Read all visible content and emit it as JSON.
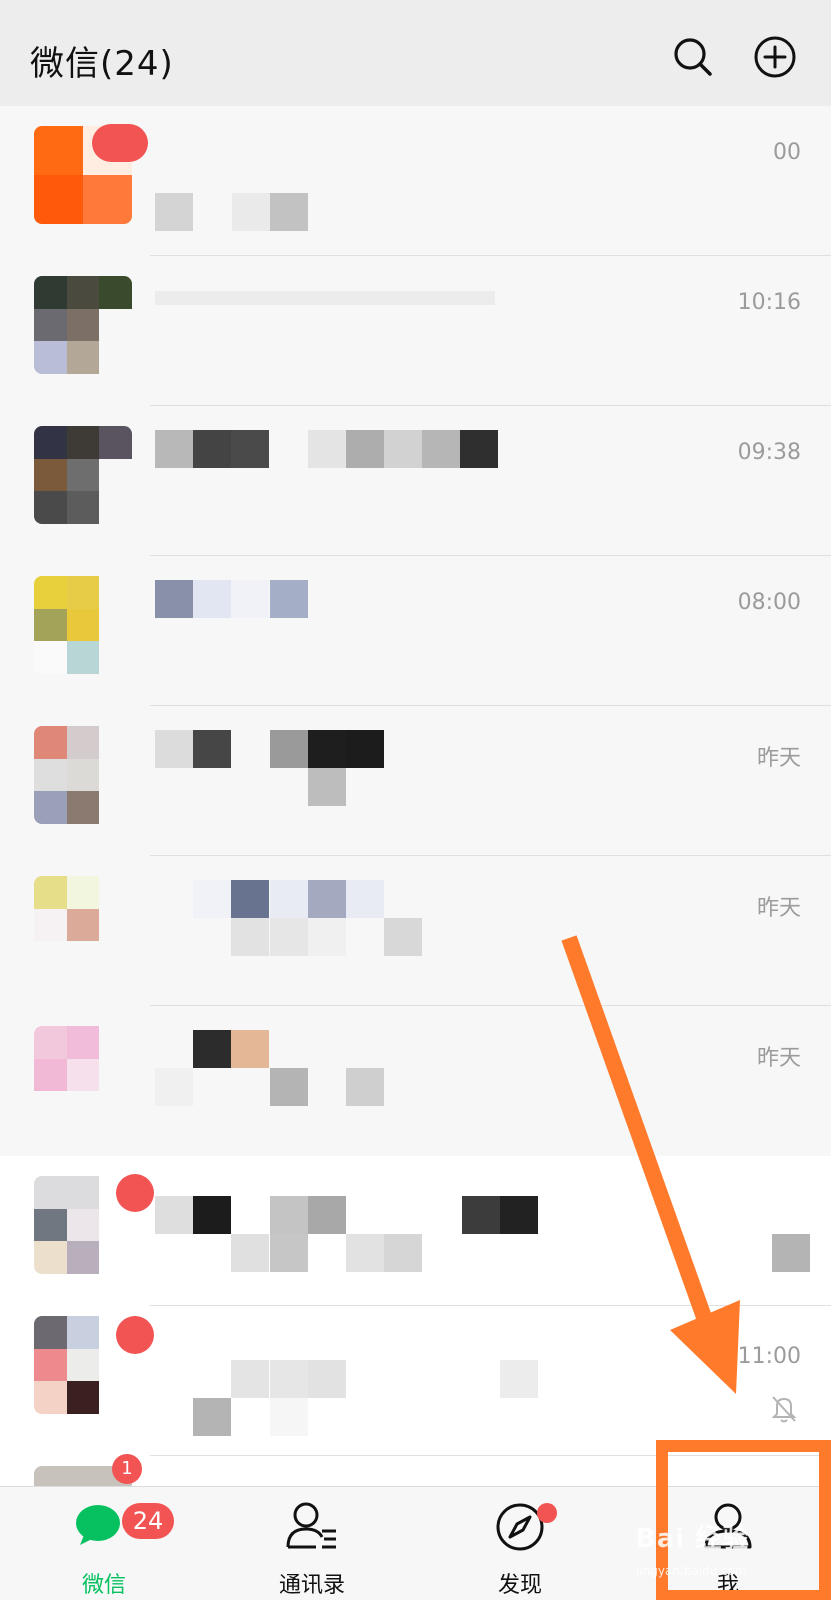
{
  "header": {
    "title": "微信(24)",
    "search_icon": "search-icon",
    "add_icon": "plus-circle-icon"
  },
  "chats": [
    {
      "time": "00",
      "unread": true
    },
    {
      "time": "10:16",
      "unread": false
    },
    {
      "time": "09:38",
      "unread": false
    },
    {
      "time": "08:00",
      "unread": false
    },
    {
      "time": "昨天",
      "unread": false
    },
    {
      "time": "昨天",
      "unread": false
    },
    {
      "time": "昨天",
      "unread": false
    },
    {
      "time": "",
      "unread": true
    },
    {
      "time": "11:00",
      "unread": true,
      "muted": true
    },
    {
      "time": "",
      "unread_count": "1"
    }
  ],
  "tabbar": {
    "tabs": [
      {
        "label": "微信",
        "badge": "24",
        "icon": "chat-bubbles-icon",
        "active": true
      },
      {
        "label": "通讯录",
        "icon": "contacts-icon"
      },
      {
        "label": "发现",
        "icon": "compass-icon",
        "dot": true
      },
      {
        "label": "我",
        "icon": "profile-icon"
      }
    ]
  },
  "annotation": {
    "accent": "#ff7a2b"
  },
  "colors": {
    "brand_green": "#07c160",
    "badge_red": "#f25454",
    "header_bg": "#ededed",
    "annotation_orange": "#ff7a2b"
  },
  "watermark": {
    "brand": "Bai 经验",
    "url": "jingyan.baidu.com"
  }
}
